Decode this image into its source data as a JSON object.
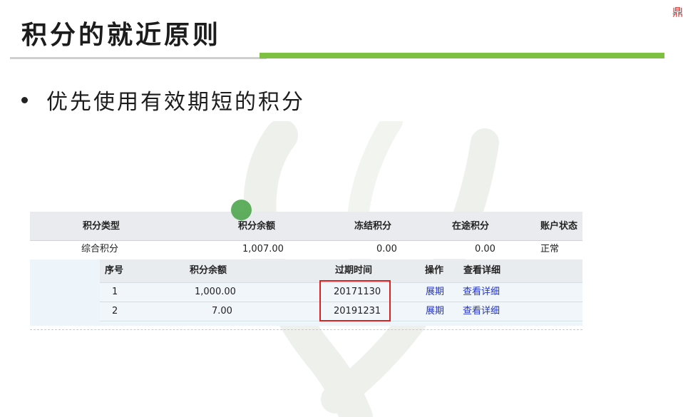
{
  "slide": {
    "title": "积分的就近原则",
    "corner_char": "鼎",
    "bullet": "优先使用有效期短的积分",
    "accent_color": "#7ec142",
    "highlight_color": "#e02020"
  },
  "summary_table": {
    "headers": [
      "积分类型",
      "积分余额",
      "冻结积分",
      "在途积分",
      "账户状态"
    ],
    "row": [
      "综合积分",
      "1,007.00",
      "0.00",
      "0.00",
      "正常"
    ]
  },
  "detail_table": {
    "headers": [
      "序号",
      "积分余额",
      "过期时间",
      "操作",
      "查看详细"
    ],
    "rows": [
      [
        "1",
        "1,000.00",
        "20171130",
        "展期",
        "查看详细"
      ],
      [
        "2",
        "7.00",
        "20191231",
        "展期",
        "查看详细"
      ]
    ]
  }
}
